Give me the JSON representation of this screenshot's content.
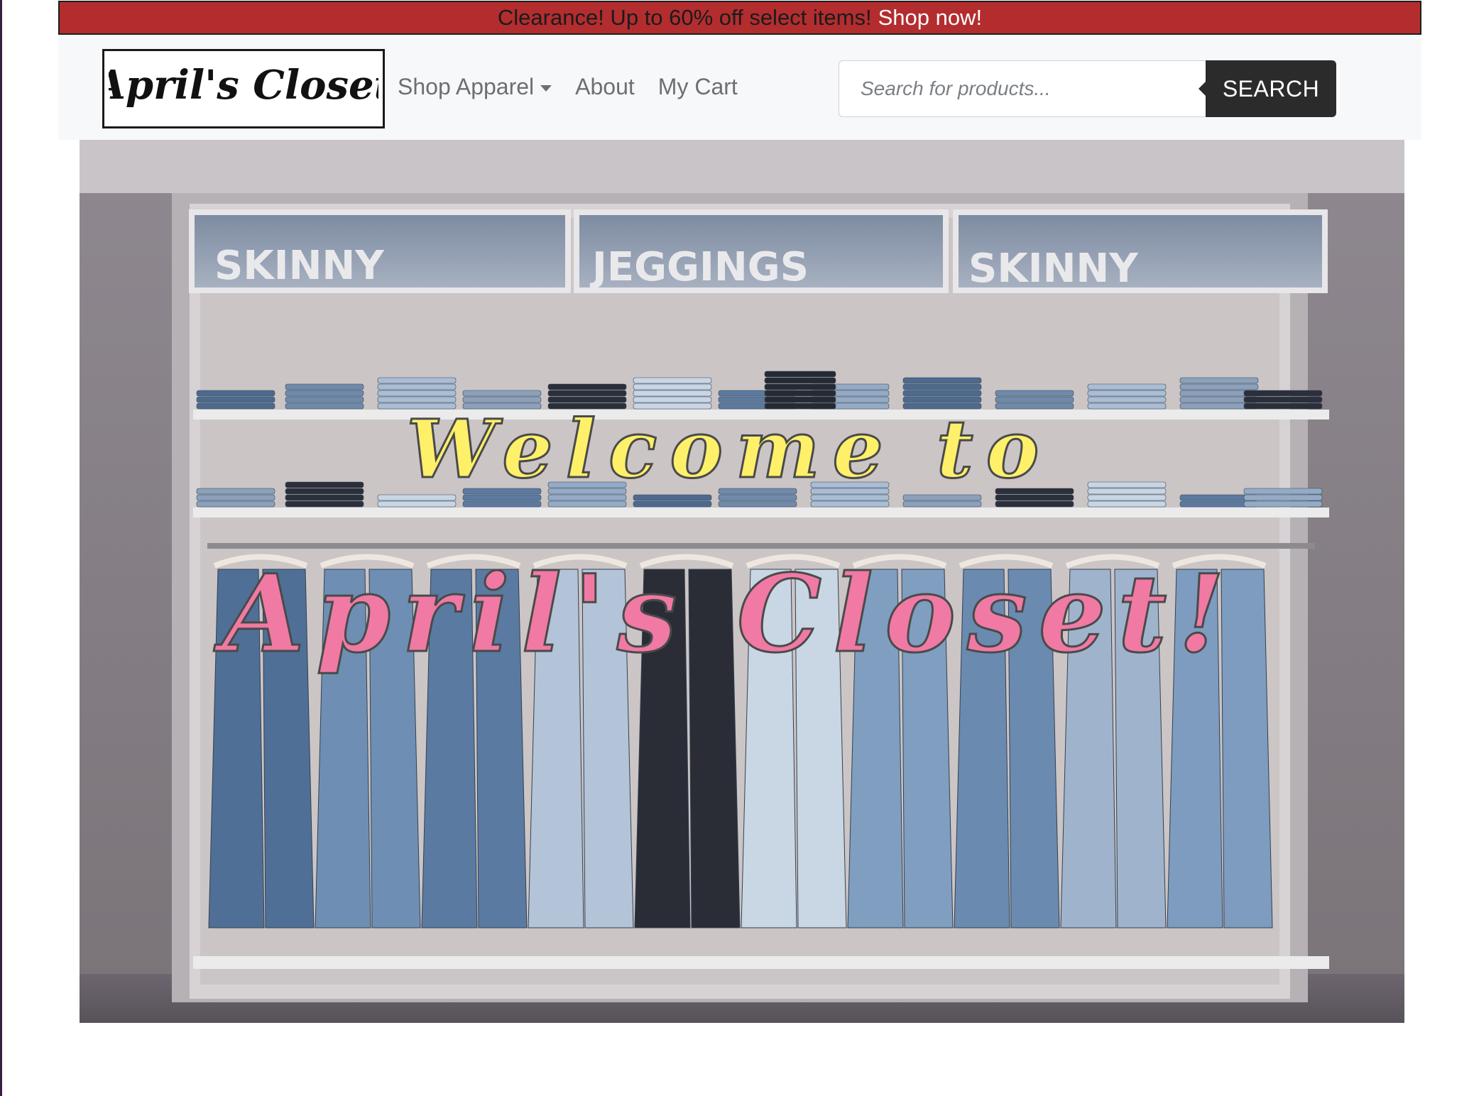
{
  "promo": {
    "text": "Clearance! Up to 60% off select items!",
    "link": "Shop now!"
  },
  "navbar": {
    "brand": "April's Closet",
    "links": [
      {
        "label": "Shop Apparel",
        "dropdown": true
      },
      {
        "label": "About"
      },
      {
        "label": "My Cart"
      }
    ],
    "search": {
      "placeholder": "Search for products...",
      "value": "",
      "button_label": "SEARCH"
    }
  },
  "hero": {
    "headline_line1": "Welcome to",
    "headline_line2": "April's Closet!",
    "signs": [
      "SKINNY",
      "JEGGINGS",
      "SKINNY"
    ]
  },
  "colors": {
    "promo_bg": "#b32d2f",
    "navbar_bg": "#f7f8f9",
    "search_button_bg": "#2b2b2b",
    "headline1_color": "#fff06a",
    "headline2_color": "#f07aa4"
  }
}
